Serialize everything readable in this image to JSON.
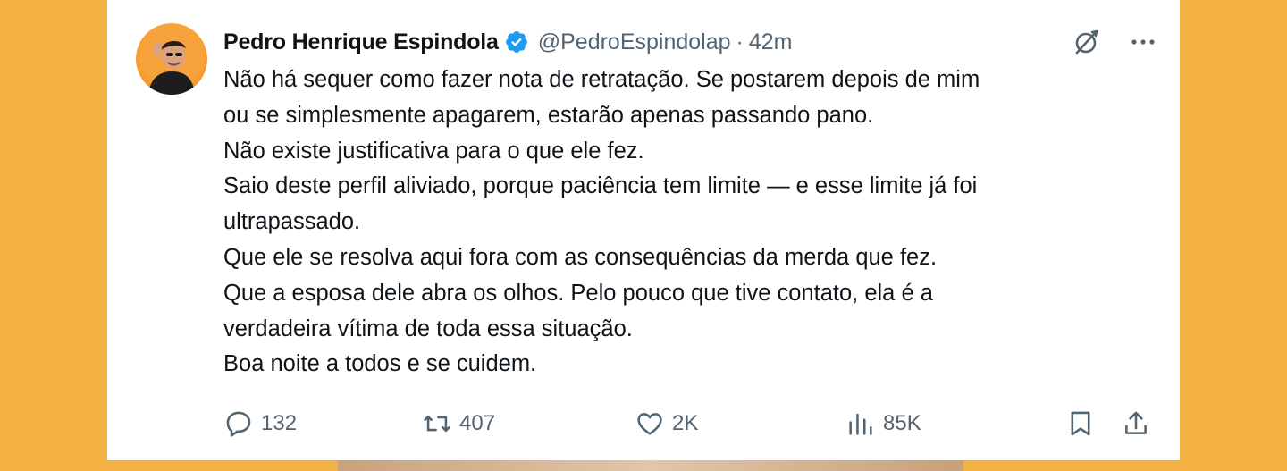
{
  "tweet": {
    "author_name": "Pedro Henrique Espindola",
    "handle": "@PedroEspindolap",
    "separator": "·",
    "time": "42m",
    "body": "Não há sequer como fazer nota de retratação. Se postarem depois de mim\nou se simplesmente apagarem, estarão apenas passando pano.\nNão existe justificativa para o que ele fez.\nSaio deste perfil aliviado, porque paciência tem limite — e esse limite já foi\nultrapassado.\nQue ele se resolva aqui fora com as consequências da merda que fez.\nQue a esposa dele abra os olhos. Pelo pouco que tive contato, ela é a\nverdadeira vítima de toda essa situação.\nBoa noite a todos e se cuidem."
  },
  "actions": {
    "replies": "132",
    "reposts": "407",
    "likes": "2K",
    "views": "85K"
  },
  "colors": {
    "background": "#f2b140",
    "card": "#ffffff",
    "text": "#0f1419",
    "secondary": "#536471",
    "verified": "#1d9bf0"
  },
  "icons": {
    "verified": "verified-badge-icon",
    "grok": "grok-icon",
    "more": "more-icon",
    "reply": "reply-icon",
    "repost": "repost-icon",
    "like": "heart-icon",
    "views": "views-icon",
    "bookmark": "bookmark-icon",
    "share": "share-icon"
  }
}
